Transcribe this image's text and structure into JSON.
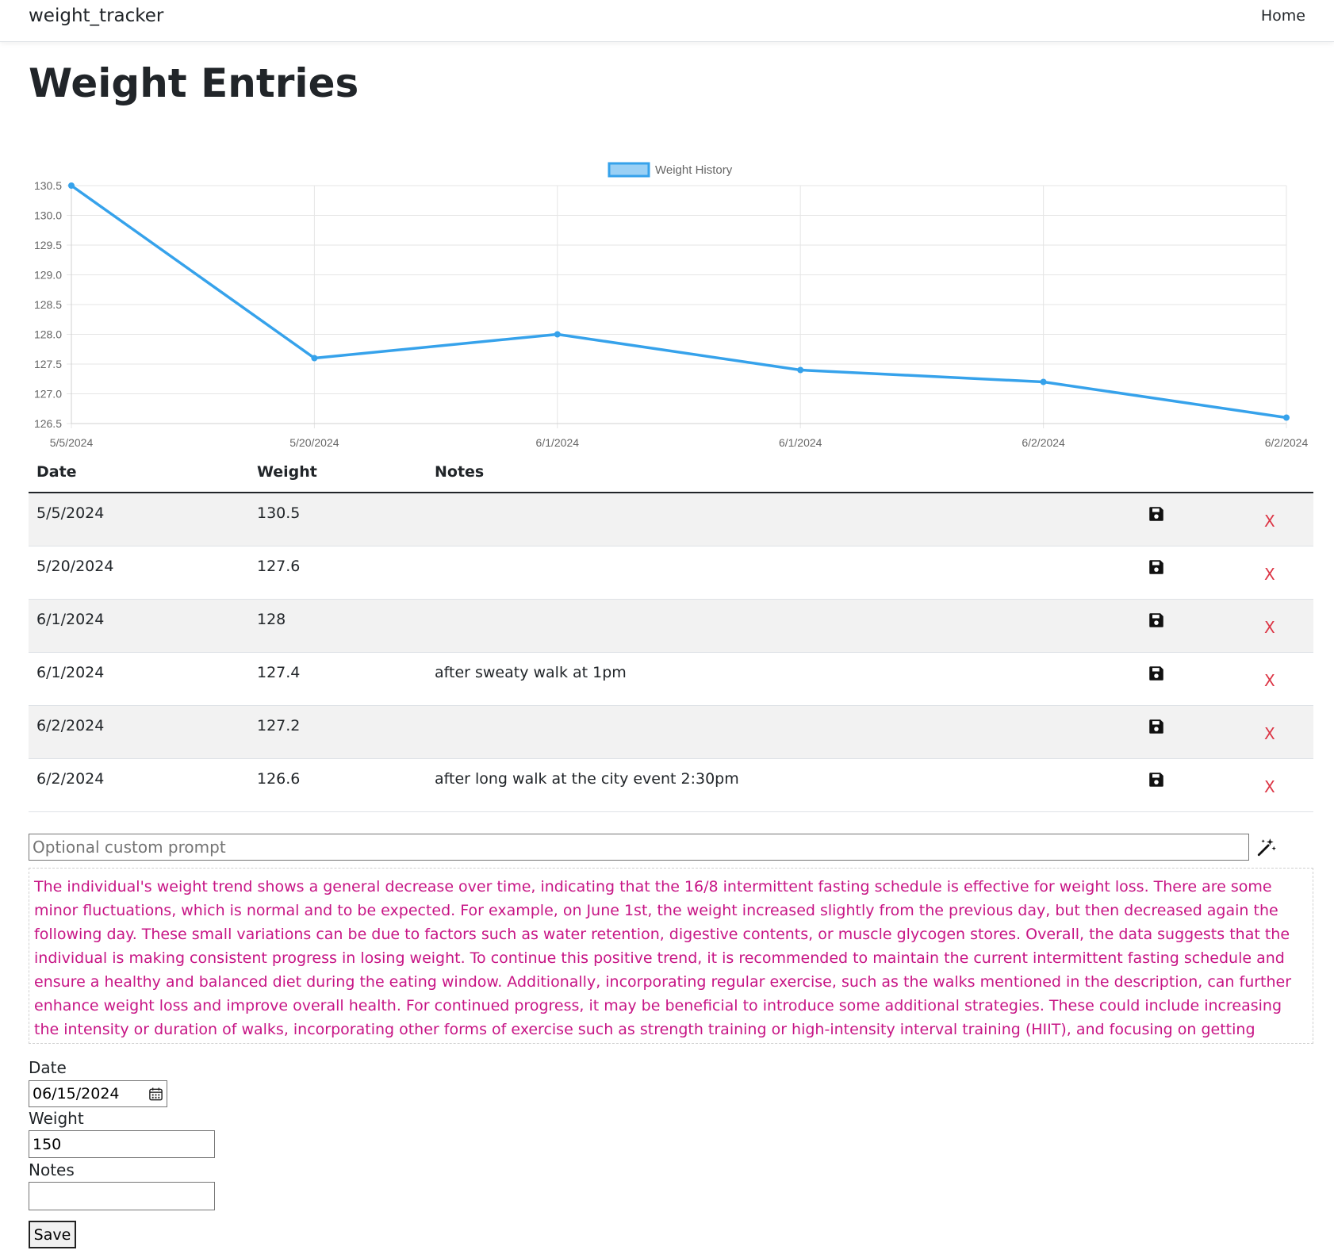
{
  "nav": {
    "brand": "weight_tracker",
    "home": "Home"
  },
  "page": {
    "title": "Weight Entries"
  },
  "chart_data": {
    "type": "line",
    "title": "",
    "xlabel": "",
    "ylabel": "",
    "legend_position": "top-center",
    "grid": true,
    "categories": [
      "5/5/2024",
      "5/20/2024",
      "6/1/2024",
      "6/1/2024",
      "6/2/2024",
      "6/2/2024"
    ],
    "series": [
      {
        "name": "Weight History",
        "values": [
          130.5,
          127.6,
          128.0,
          127.4,
          127.2,
          126.6
        ],
        "color": "#36a2eb"
      }
    ],
    "ylim": [
      126.5,
      130.5
    ],
    "yticks": [
      "126.5",
      "127.0",
      "127.5",
      "128.0",
      "128.5",
      "129.0",
      "129.5",
      "130.0",
      "130.5"
    ]
  },
  "table": {
    "headers": {
      "date": "Date",
      "weight": "Weight",
      "notes": "Notes"
    },
    "delete_label": "X",
    "rows": [
      {
        "date": "5/5/2024",
        "weight": "130.5",
        "notes": ""
      },
      {
        "date": "5/20/2024",
        "weight": "127.6",
        "notes": ""
      },
      {
        "date": "6/1/2024",
        "weight": "128",
        "notes": ""
      },
      {
        "date": "6/1/2024",
        "weight": "127.4",
        "notes": "after sweaty walk at 1pm"
      },
      {
        "date": "6/2/2024",
        "weight": "127.2",
        "notes": ""
      },
      {
        "date": "6/2/2024",
        "weight": "126.6",
        "notes": "after long walk at the city event 2:30pm"
      }
    ]
  },
  "prompt": {
    "placeholder": "Optional custom prompt",
    "value": ""
  },
  "analysis": {
    "text": "The individual's weight trend shows a general decrease over time, indicating that the 16/8 intermittent fasting schedule is effective for weight loss. There are some minor fluctuations, which is normal and to be expected. For example, on June 1st, the weight increased slightly from the previous day, but then decreased again the following day. These small variations can be due to factors such as water retention, digestive contents, or muscle glycogen stores. Overall, the data suggests that the individual is making consistent progress in losing weight. To continue this positive trend, it is recommended to maintain the current intermittent fasting schedule and ensure a healthy and balanced diet during the eating window. Additionally, incorporating regular exercise, such as the walks mentioned in the description, can further enhance weight loss and improve overall health. For continued progress, it may be beneficial to introduce some additional strategies. These could include increasing the intensity or duration of walks, incorporating other forms of exercise such as strength training or high-intensity interval training (HIIT), and focusing on getting adequate sleep and managing stress levels, as these factors can also impact weight loss.",
    "color": "#c71585"
  },
  "form": {
    "date_label": "Date",
    "date_value": "06/15/2024",
    "weight_label": "Weight",
    "weight_value": "150",
    "notes_label": "Notes",
    "notes_value": "",
    "save_label": "Save"
  },
  "icons": {
    "save": "floppy-disk-icon",
    "magic": "magic-wand-icon",
    "calendar": "calendar-icon"
  },
  "colors": {
    "accent": "#36a2eb",
    "delete": "#dc3545",
    "analysis_text": "#c71585"
  }
}
